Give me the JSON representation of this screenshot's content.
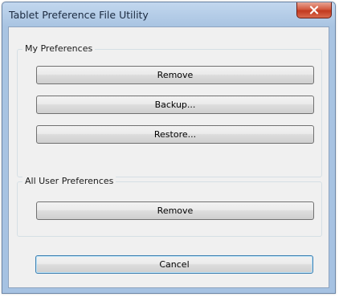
{
  "window": {
    "title": "Tablet Preference File Utility",
    "close_icon": "close-x-icon"
  },
  "my_preferences": {
    "caption": "My Preferences",
    "remove_label": "Remove",
    "backup_label": "Backup...",
    "restore_label": "Restore..."
  },
  "all_user_preferences": {
    "caption": "All User Preferences",
    "remove_label": "Remove"
  },
  "footer": {
    "cancel_label": "Cancel"
  },
  "colors": {
    "titlebar": "#a9c4e2",
    "close_button": "#c2391f",
    "dialog_background": "#f0f0f0"
  }
}
